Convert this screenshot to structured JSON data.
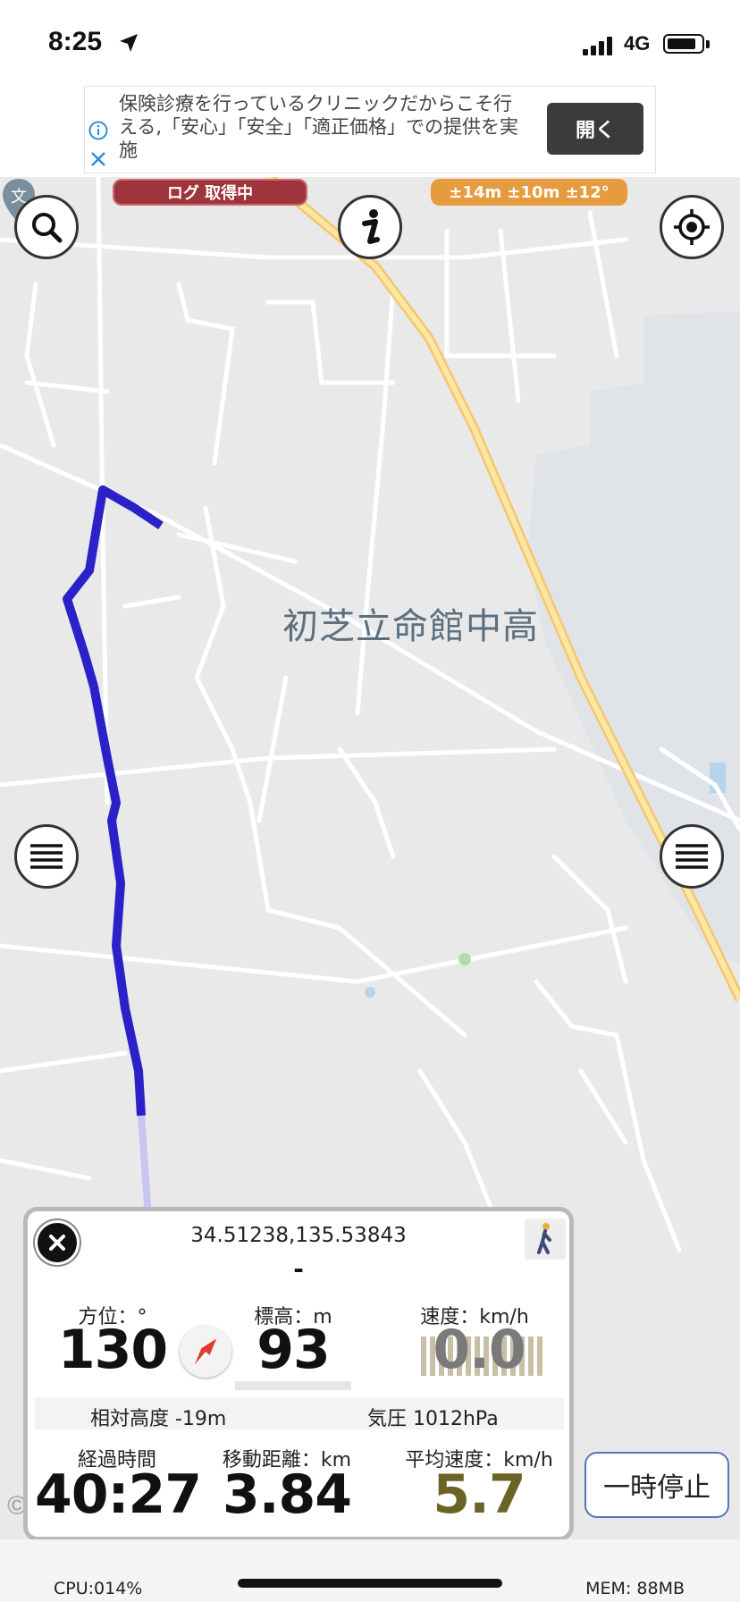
{
  "status_bar": {
    "time": "8:25",
    "network": "4G",
    "battery_level": 0.85
  },
  "ad": {
    "text": "保険診療を行っているクリニックだからこそ行える,「安心」「安全」「適正価格」での提供を実施",
    "open_label": "開く"
  },
  "map": {
    "place_label": "初芝立命館中高",
    "poi_icon": "school-pin-icon",
    "attribution": "©G"
  },
  "badges": {
    "log_status": "ログ 取得中",
    "accuracy": "±14m ±10m ±12°"
  },
  "buttons": {
    "search_icon": "search-icon",
    "info_icon": "info-icon",
    "locate_icon": "locate-icon",
    "menu_icon": "hamburger-menu-icon",
    "pause_label": "一時停止"
  },
  "panel": {
    "coordinates": "34.51238,135.53843",
    "address": "-",
    "bearing_label": "方位：°",
    "bearing_value": "130",
    "bearing_degrees": 130,
    "elevation_label": "標高：m",
    "elevation_value": "93",
    "speed_label": "速度：km/h",
    "speed_value": "0.0",
    "relative_altitude": "相対高度 -19m",
    "pressure": "気圧 1012hPa",
    "elapsed_label": "経過時間",
    "elapsed_value": "40:27",
    "distance_label": "移動距離：km",
    "distance_value": "3.84",
    "avg_speed_label": "平均速度：km/h",
    "avg_speed_value": "5.7",
    "avg_speed_color": "#6b6326"
  },
  "footer": {
    "cpu": "CPU:014%",
    "mem": "MEM: 88MB"
  }
}
